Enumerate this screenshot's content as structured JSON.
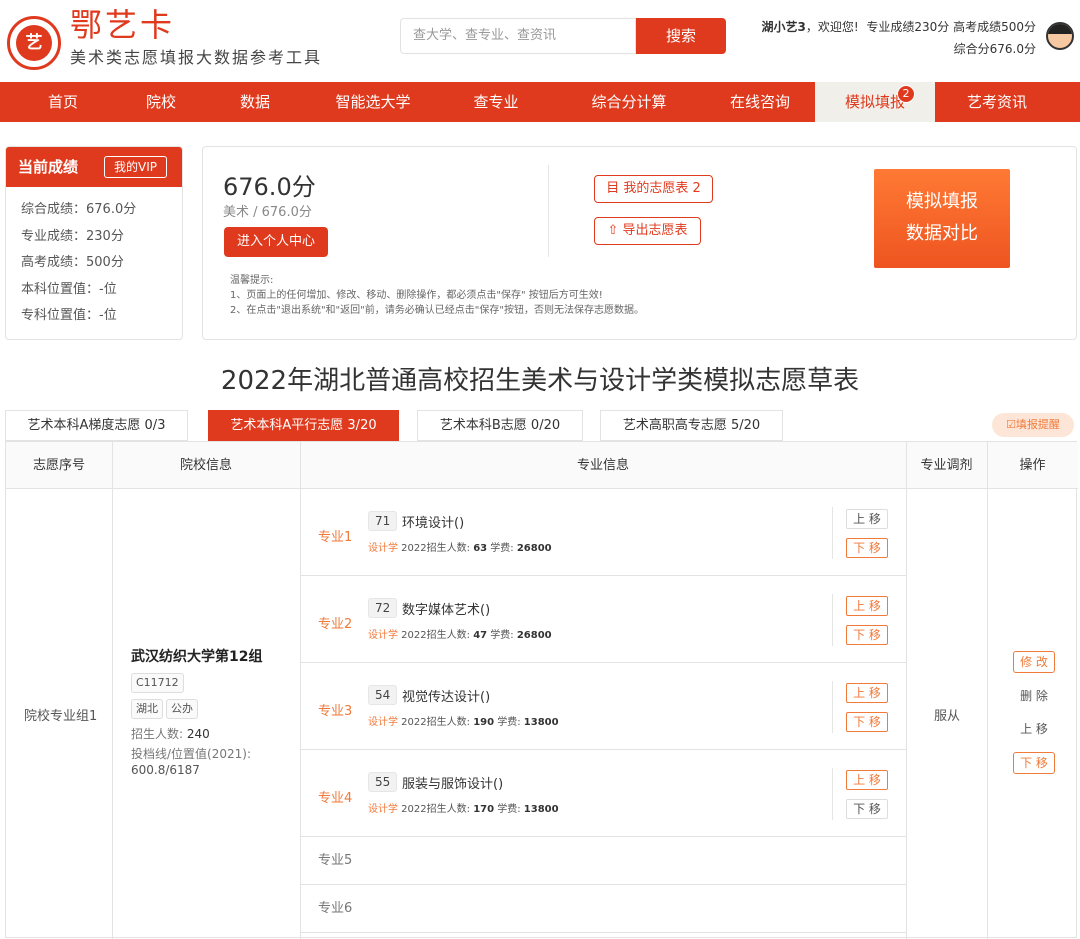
{
  "header": {
    "logo_text": "艺",
    "brand": "鄂艺卡",
    "subtitle": "美术类志愿填报大数据参考工具",
    "search_placeholder": "查大学、查专业、查资讯",
    "search_button": "搜索",
    "user_name": "湖小艺3",
    "greeting": "，欢迎您!",
    "major_score": "专业成绩230分",
    "exam_score": "高考成绩500分",
    "total_score": "综合分676.0分"
  },
  "nav": [
    "首页",
    "院校",
    "数据",
    "智能选大学",
    "查专业",
    "综合分计算",
    "在线咨询",
    "模拟填报",
    "艺考资讯"
  ],
  "nav_badge": "2",
  "score_panel": {
    "title": "当前成绩",
    "vip": "我的VIP",
    "rows": [
      "综合成绩：676.0分",
      "专业成绩：230分",
      "高考成绩：500分",
      "本科位置值：-位",
      "专科位置值：-位"
    ]
  },
  "main_panel": {
    "score": "676.0分",
    "category": "美术 / 676.0分",
    "center_button": "进入个人中心",
    "my_list": "目 我的志愿表 2",
    "export": "⇧ 导出志愿表",
    "compare_line1": "模拟填报",
    "compare_line2": "数据对比",
    "tips_title": "温馨提示:",
    "tip1": "1、页面上的任何增加、修改、移动、删除操作，都必须点击\"保存\" 按钮后方可生效!",
    "tip2": "2、在点击\"退出系统\"和\"返回\"前，请务必确认已经点击\"保存\"按钮，否则无法保存志愿数据。"
  },
  "page_title": "2022年湖北普通高校招生美术与设计学类模拟志愿草表",
  "tabs": [
    "艺术本科A梯度志愿 0/3",
    "艺术本科A平行志愿 3/20",
    "艺术本科B志愿 0/20",
    "艺术高职高专志愿 5/20"
  ],
  "remind": "☑填报提醒",
  "table": {
    "headers": [
      "志愿序号",
      "院校信息",
      "专业信息",
      "专业调剂",
      "操作"
    ],
    "group": "院校专业组1",
    "school": {
      "name": "武汉纺织大学第12组",
      "code": "C11712",
      "tags": [
        "湖北",
        "公办"
      ],
      "enroll_label": "招生人数: ",
      "enroll": "240",
      "line_label": "投档线/位置值(2021):",
      "line_value": "600.8/6187"
    },
    "majors": [
      {
        "no": "专业1",
        "code": "71",
        "name": "环境设计()",
        "subject": "设计学",
        "enroll_label": " 2022招生人数: ",
        "enroll": "63",
        "fee_label": "  学费: ",
        "fee": "26800",
        "up": "上 移",
        "down": "下 移"
      },
      {
        "no": "专业2",
        "code": "72",
        "name": "数字媒体艺术()",
        "subject": "设计学",
        "enroll_label": " 2022招生人数: ",
        "enroll": "47",
        "fee_label": "  学费: ",
        "fee": "26800",
        "up": "上 移",
        "down": "下 移"
      },
      {
        "no": "专业3",
        "code": "54",
        "name": "视觉传达设计()",
        "subject": "设计学",
        "enroll_label": " 2022招生人数: ",
        "enroll": "190",
        "fee_label": "  学费: ",
        "fee": "13800",
        "up": "上 移",
        "down": "下 移"
      },
      {
        "no": "专业4",
        "code": "55",
        "name": "服装与服饰设计()",
        "subject": "设计学",
        "enroll_label": " 2022招生人数: ",
        "enroll": "170",
        "fee_label": "  学费: ",
        "fee": "13800",
        "up": "上 移",
        "down": "下 移"
      }
    ],
    "empty_slots": [
      "专业5",
      "专业6"
    ],
    "adjust": "服从",
    "ops": [
      "修 改",
      "删 除",
      "上 移",
      "下 移"
    ]
  },
  "colors": {
    "accent": "#e03a1e",
    "orange": "#f07a3a"
  }
}
